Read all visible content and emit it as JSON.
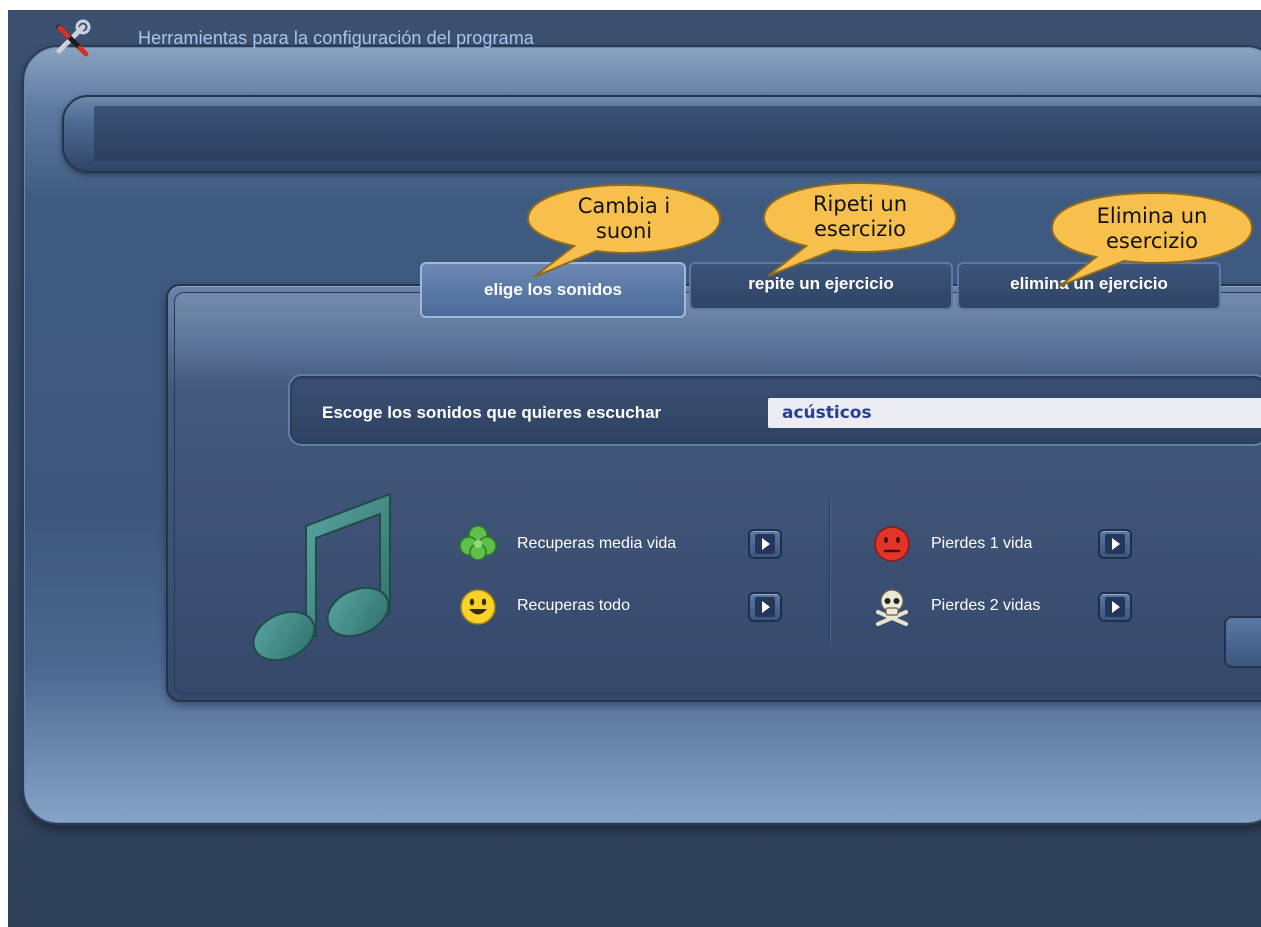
{
  "header": {
    "title": "Herramientas para la configuración del programa",
    "icon": "tools-icon"
  },
  "tabs": [
    {
      "label": "elige los sonidos",
      "active": true
    },
    {
      "label": "repite un ejercicio",
      "active": false
    },
    {
      "label": "elimina un ejercicio",
      "active": false
    }
  ],
  "callouts": [
    {
      "text_line1": "Cambia i",
      "text_line2": "suoni"
    },
    {
      "text_line1": "Ripeti un",
      "text_line2": "esercizio"
    },
    {
      "text_line1": "Elimina un",
      "text_line2": "esercizio"
    }
  ],
  "sound_selector": {
    "label": "Escoge los sonidos que quieres escuchar",
    "value": "acústicos"
  },
  "sounds": {
    "left": [
      {
        "label": "Recuperas media vida",
        "icon": "clover-icon"
      },
      {
        "label": "Recuperas todo",
        "icon": "smiley-icon"
      }
    ],
    "right": [
      {
        "label": "Pierdes 1 vida",
        "icon": "sad-face-icon"
      },
      {
        "label": "Pierdes 2 vidas",
        "icon": "skull-icon"
      }
    ]
  },
  "colors": {
    "background": "#344863",
    "title_text": "#a9c6ee",
    "selector_value_text": "#273f9a",
    "music_note": "#3f8a86",
    "callout_fill": "#f7c04d"
  }
}
